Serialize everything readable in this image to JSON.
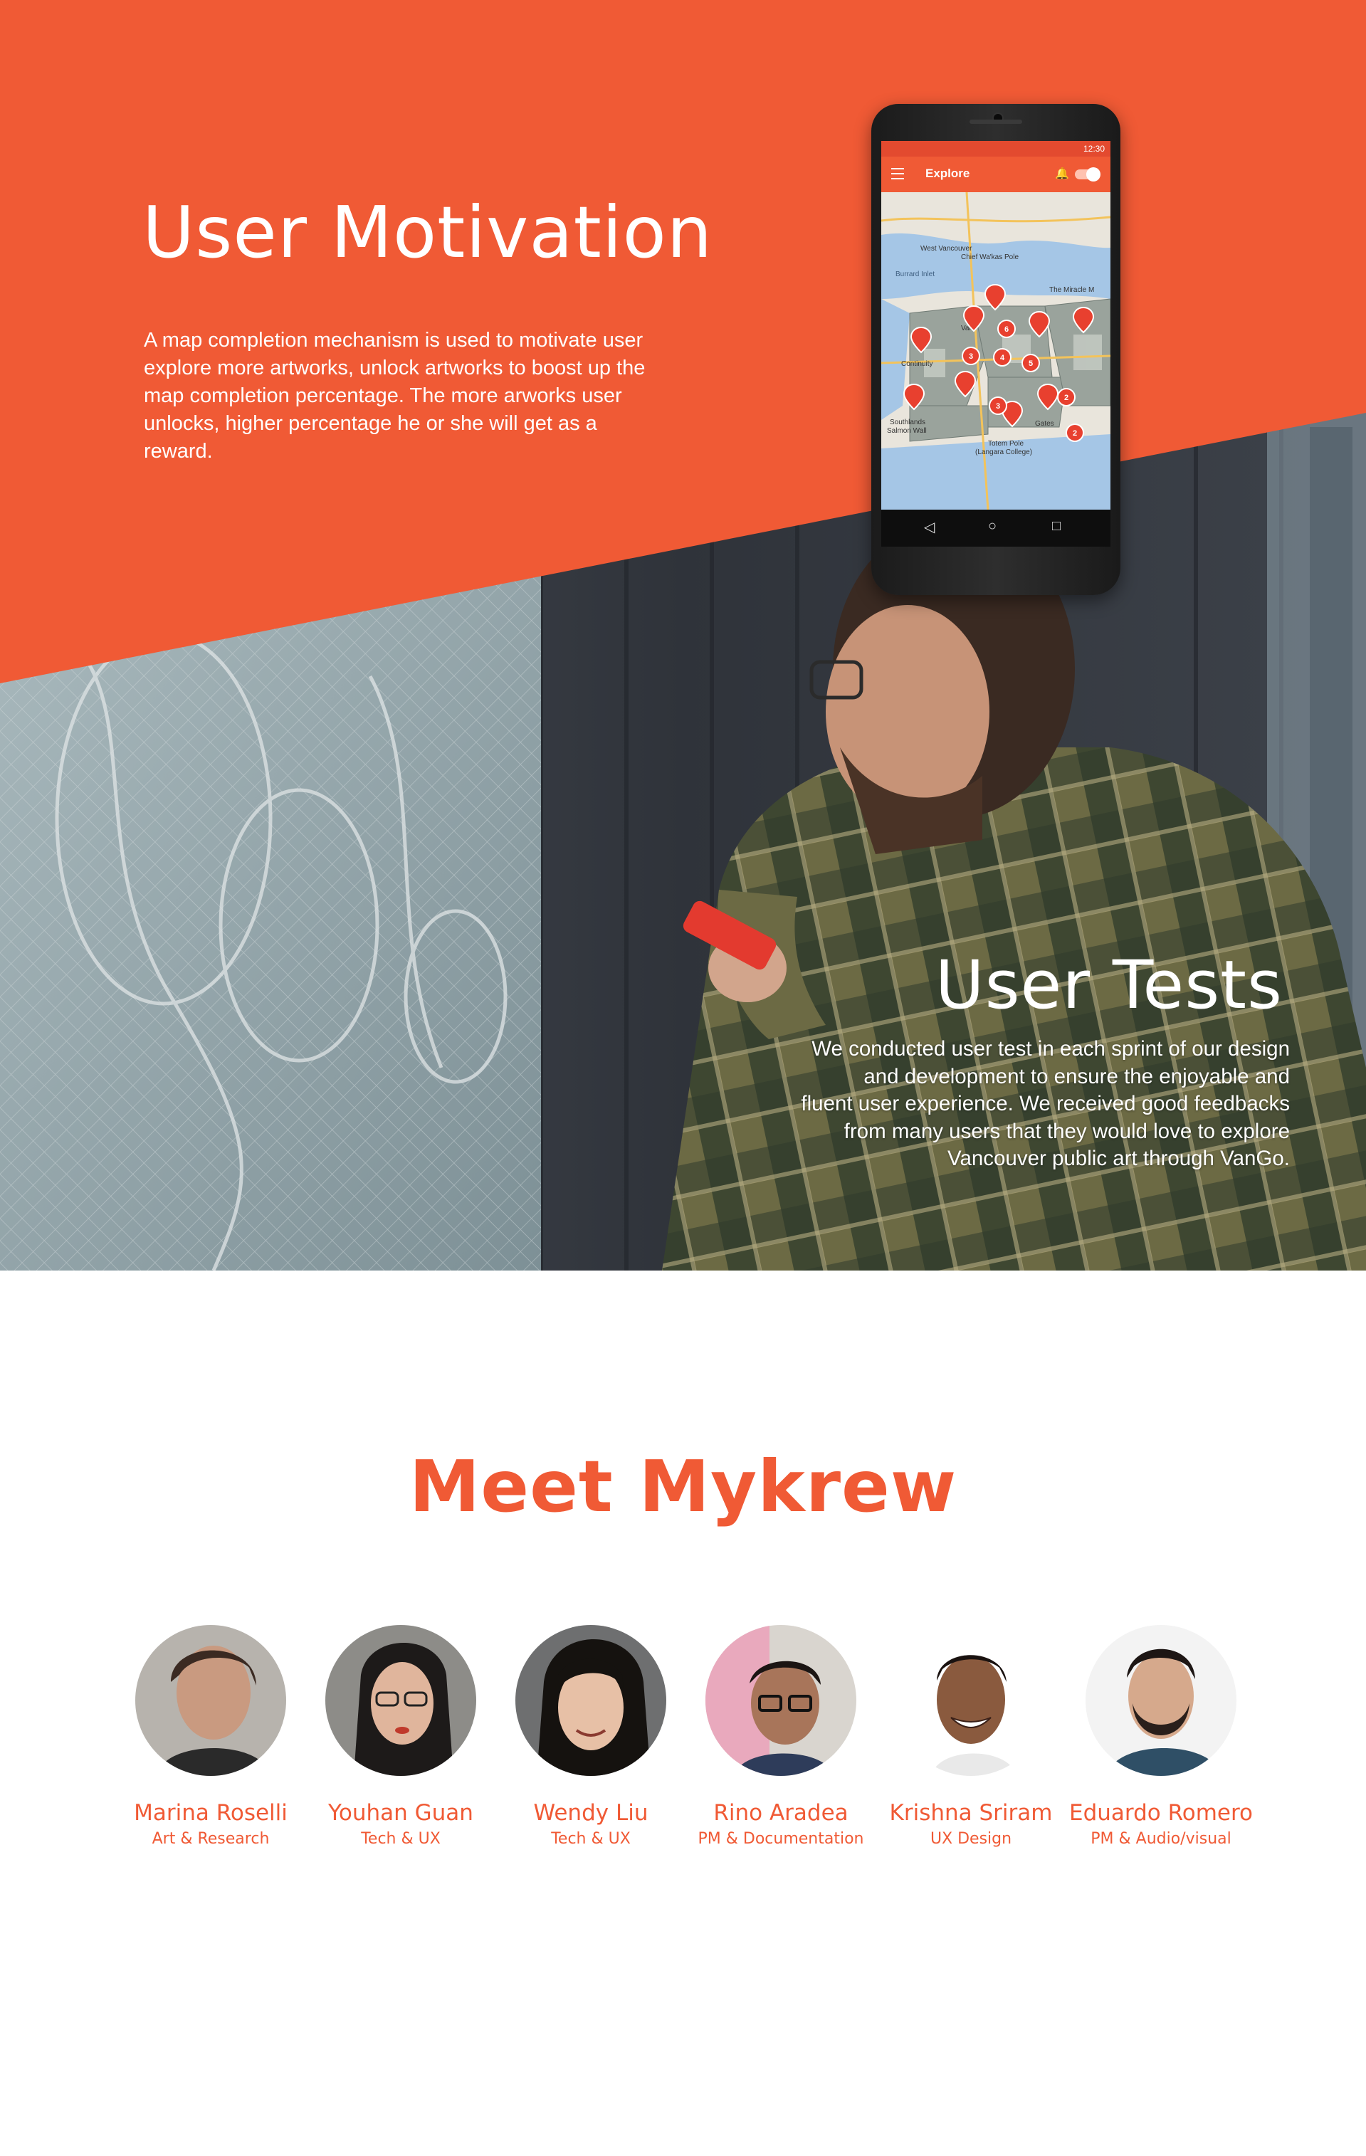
{
  "colors": {
    "accent": "#f05a35",
    "background": "#ffffff"
  },
  "motivation": {
    "title": "User Motivation",
    "body": "A map completion mechanism is used to motivate user explore more artworks, unlock artworks to boost up the map completion percentage. The more arworks user unlocks, higher percentage he or she will get as a reward."
  },
  "phone": {
    "status_time": "12:30",
    "app_title": "Explore",
    "map_labels": [
      "West Vancouver",
      "Chief Wa'kas Pole",
      "Burrard Inlet",
      "The Miracle M",
      "Continuity",
      "Southlands",
      "Salmon Wall",
      "Totem Pole",
      "(Langara College)",
      "Gates",
      "Van"
    ],
    "cluster_counts": [
      "6",
      "3",
      "4",
      "5",
      "3",
      "2",
      "2"
    ]
  },
  "tests": {
    "title": "User Tests",
    "body_lines": [
      "We conducted user test in each sprint of our design",
      "and development to ensure the enjoyable and",
      "fluent user experience. We received good feedbacks",
      "from many users that they would love to explore",
      "Vancouver public art through VanGo."
    ]
  },
  "team": {
    "title": "Meet Mykrew",
    "members": [
      {
        "name": "Marina Roselli",
        "role": "Art & Research"
      },
      {
        "name": "Youhan Guan",
        "role": "Tech & UX"
      },
      {
        "name": "Wendy Liu",
        "role": "Tech & UX"
      },
      {
        "name": "Rino Aradea",
        "role": "PM & Documentation"
      },
      {
        "name": "Krishna Sriram",
        "role": "UX Design"
      },
      {
        "name": "Eduardo Romero",
        "role": "PM & Audio/visual"
      }
    ]
  }
}
